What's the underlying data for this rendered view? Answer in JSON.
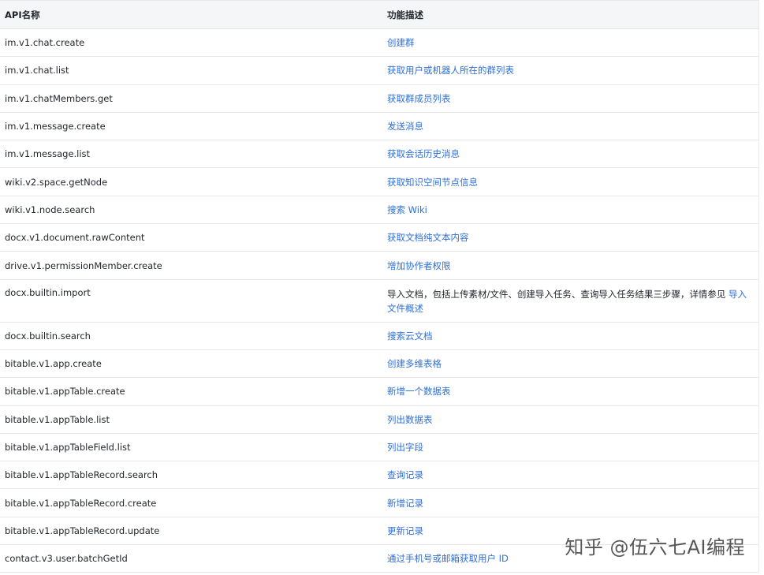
{
  "table": {
    "headers": {
      "api": "API名称",
      "desc": "功能描述"
    },
    "rows": [
      {
        "api": "im.v1.chat.create",
        "desc": "创建群"
      },
      {
        "api": "im.v1.chat.list",
        "desc": "获取用户或机器人所在的群列表"
      },
      {
        "api": "im.v1.chatMembers.get",
        "desc": "获取群成员列表"
      },
      {
        "api": "im.v1.message.create",
        "desc": "发送消息"
      },
      {
        "api": "im.v1.message.list",
        "desc": "获取会话历史消息"
      },
      {
        "api": "wiki.v2.space.getNode",
        "desc": "获取知识空间节点信息"
      },
      {
        "api": "wiki.v1.node.search",
        "desc": "搜索 Wiki"
      },
      {
        "api": "docx.v1.document.rawContent",
        "desc": "获取文档纯文本内容"
      },
      {
        "api": "drive.v1.permissionMember.create",
        "desc": "增加协作者权限"
      },
      {
        "api": "docx.builtin.import",
        "desc_text": "导入文档，包括上传素材/文件、创建导入任务、查询导入任务结果三步骤，详情参见 ",
        "desc_link": "导入文件概述"
      },
      {
        "api": "docx.builtin.search",
        "desc": "搜索云文档"
      },
      {
        "api": "bitable.v1.app.create",
        "desc": "创建多维表格"
      },
      {
        "api": "bitable.v1.appTable.create",
        "desc": "新增一个数据表"
      },
      {
        "api": "bitable.v1.appTable.list",
        "desc": "列出数据表"
      },
      {
        "api": "bitable.v1.appTableField.list",
        "desc": "列出字段"
      },
      {
        "api": "bitable.v1.appTableRecord.search",
        "desc": "查询记录"
      },
      {
        "api": "bitable.v1.appTableRecord.create",
        "desc": "新增记录"
      },
      {
        "api": "bitable.v1.appTableRecord.update",
        "desc": "更新记录"
      },
      {
        "api": "contact.v3.user.batchGetId",
        "desc": "通过手机号或邮箱获取用户 ID"
      }
    ]
  },
  "watermark": "知乎 @伍六七AI编程",
  "colors": {
    "link": "#2f6fd8",
    "header_bg": "#f5f6f7",
    "border": "#e6e8eb",
    "text": "#1f2329"
  }
}
